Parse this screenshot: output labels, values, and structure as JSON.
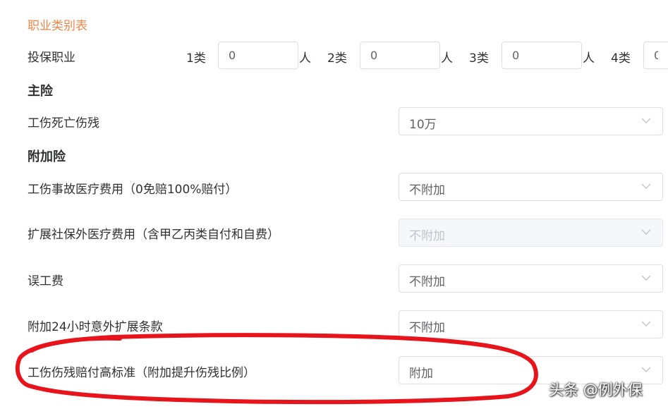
{
  "occupation_table_link": "职业类别表",
  "insured_occupation": {
    "label": "投保职业",
    "unit": "人",
    "classes": [
      {
        "label": "1类",
        "value": "0"
      },
      {
        "label": "2类",
        "value": "0"
      },
      {
        "label": "3类",
        "value": "0"
      },
      {
        "label": "4类",
        "value": "0"
      }
    ]
  },
  "main_insurance": {
    "title": "主险",
    "items": [
      {
        "label": "工伤死亡伤残",
        "value": "10万",
        "disabled": false
      }
    ]
  },
  "additional_insurance": {
    "title": "附加险",
    "items": [
      {
        "label": "工伤事故医疗费用（0免赔100%赔付）",
        "value": "不附加",
        "disabled": false
      },
      {
        "label": "扩展社保外医疗费用（含甲乙丙类自付和自费）",
        "value": "不附加",
        "disabled": true
      },
      {
        "label": "误工费",
        "value": "不附加",
        "disabled": false
      },
      {
        "label": "附加24小时意外扩展条款",
        "value": "不附加",
        "disabled": false
      },
      {
        "label": "工伤伤残赔付高标准（附加提升伤残比例）",
        "value": "附加",
        "disabled": false
      }
    ]
  },
  "annotation_color": "#e8141b",
  "watermark": "头条 @例外保"
}
